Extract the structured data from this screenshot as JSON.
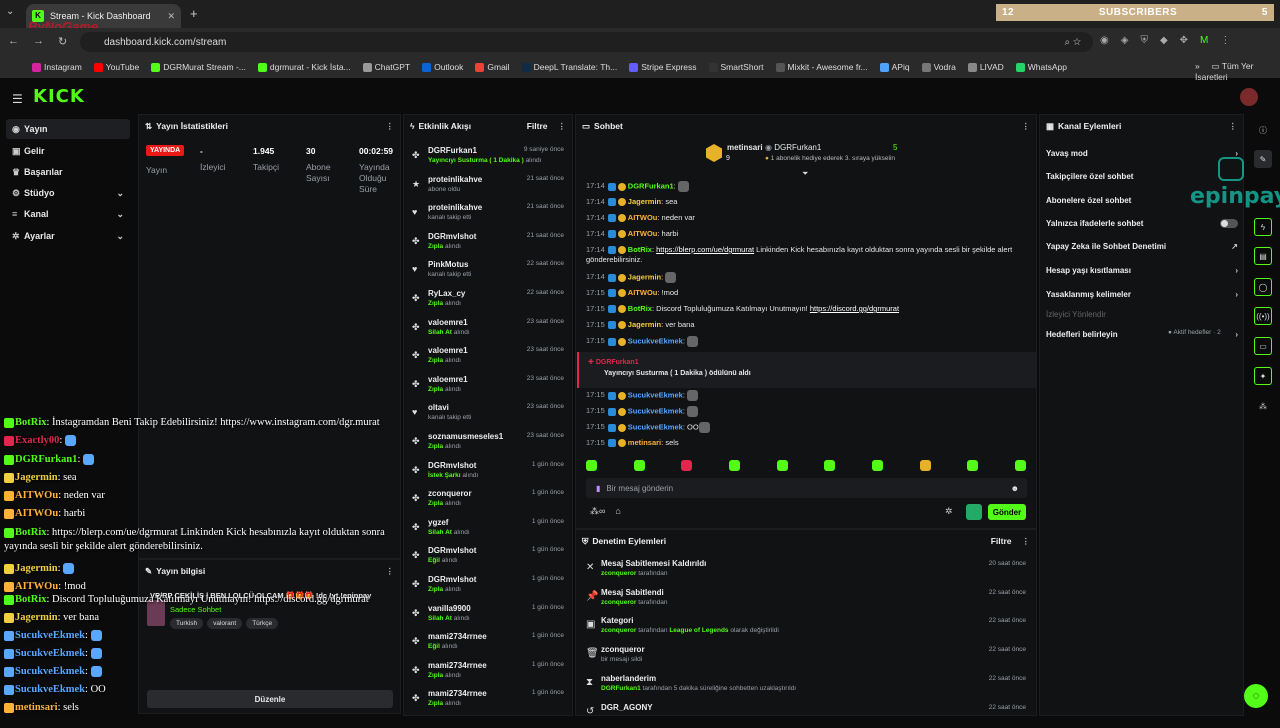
{
  "browser": {
    "tab_title": "Stream - Kick Dashboard",
    "url": "dashboard.kick.com/stream",
    "watermark": "ByNoGame",
    "subscribers": {
      "left": "12",
      "label": "SUBSCRIBERS",
      "right": "5"
    },
    "bookmarks": [
      "Instagram",
      "YouTube",
      "DGRMurat Stream -...",
      "dgrmurat - Kick İsta...",
      "ChatGPT",
      "Outlook",
      "Gmail",
      "DeepL Translate: Th...",
      "Stripe Express",
      "SmartShort",
      "Mixkit - Awesome fr...",
      "APiq",
      "Vodra",
      "LIVAD",
      "WhatsApp"
    ],
    "all_bookmarks": "Tüm Yer İşaretleri"
  },
  "app": {
    "logo": "KICK"
  },
  "sidebar": {
    "items": [
      {
        "label": "Yayın",
        "icon": "broadcast-icon"
      },
      {
        "label": "Gelir",
        "icon": "dollar-icon"
      },
      {
        "label": "Başarılar",
        "icon": "trophy-icon"
      },
      {
        "label": "Stüdyo",
        "icon": "studio-icon"
      },
      {
        "label": "Kanal",
        "icon": "channel-icon"
      },
      {
        "label": "Ayarlar",
        "icon": "gear-icon"
      }
    ]
  },
  "stats": {
    "title": "Yayın İstatistikleri",
    "live": "YAYINDA",
    "cells": [
      {
        "value": "",
        "label": "Yayın"
      },
      {
        "value": "-",
        "label": "İzleyici"
      },
      {
        "value": "1.945",
        "label": "Takipçi"
      },
      {
        "value": "30",
        "label": "Abone Sayısı"
      },
      {
        "value": "00:02:59",
        "label": "Yayında Olduğu Süre"
      }
    ]
  },
  "stream_info": {
    "title": "Yayın bilgisi",
    "stream_title": "VP/RP ÇEKİLİŞ | BEN LOLCÜ OLÇAM 🎁🎁🎁 !dc !yt !epinpay",
    "subtitle": "Sadece Sohbet",
    "tags": [
      "Turkish",
      "valorant",
      "Türkçe"
    ],
    "edit": "Düzenle"
  },
  "activity": {
    "title": "Etkinlik Akışı",
    "filter": "Filtre",
    "items": [
      {
        "name": "DGRFurkan1",
        "desc": "Yayıncıyı Susturma ( 1 Dakika )",
        "suffix": "alındı",
        "time": "9 saniye önce",
        "icon": "gift-icon"
      },
      {
        "name": "proteinlikahve",
        "desc": "",
        "suffix": "abone oldu",
        "time": "21 saat önce",
        "icon": "star-icon"
      },
      {
        "name": "proteinlikahve",
        "desc": "",
        "suffix": "kanalı takip etti",
        "time": "21 saat önce",
        "icon": "heart-icon"
      },
      {
        "name": "DGRmvlshot",
        "desc": "Zıpla",
        "suffix": "alındı",
        "time": "21 saat önce",
        "icon": "gift-icon"
      },
      {
        "name": "PinkMotus",
        "desc": "",
        "suffix": "kanalı takip etti",
        "time": "22 saat önce",
        "icon": "heart-icon"
      },
      {
        "name": "RyLax_cy",
        "desc": "Zıpla",
        "suffix": "alındı",
        "time": "22 saat önce",
        "icon": "gift-icon"
      },
      {
        "name": "valoemre1",
        "desc": "Silah At",
        "suffix": "alındı",
        "time": "23 saat önce",
        "icon": "gift-icon"
      },
      {
        "name": "valoemre1",
        "desc": "Zıpla",
        "suffix": "alındı",
        "time": "23 saat önce",
        "icon": "gift-icon"
      },
      {
        "name": "valoemre1",
        "desc": "Zıpla",
        "suffix": "alındı",
        "time": "23 saat önce",
        "icon": "gift-icon"
      },
      {
        "name": "oltavi",
        "desc": "",
        "suffix": "kanalı takip etti",
        "time": "23 saat önce",
        "icon": "heart-icon"
      },
      {
        "name": "soznamusmeseles1",
        "desc": "Zıpla",
        "suffix": "alındı",
        "time": "23 saat önce",
        "icon": "gift-icon"
      },
      {
        "name": "DGRmvlshot",
        "desc": "İstek Şarkı",
        "suffix": "alındı",
        "time": "1 gün önce",
        "icon": "gift-icon"
      },
      {
        "name": "zconqueror",
        "desc": "Zıpla",
        "suffix": "alındı",
        "time": "1 gün önce",
        "icon": "gift-icon"
      },
      {
        "name": "ygzef",
        "desc": "Silah At",
        "suffix": "alındı",
        "time": "1 gün önce",
        "icon": "gift-icon"
      },
      {
        "name": "DGRmvlshot",
        "desc": "Eğil",
        "suffix": "alındı",
        "time": "1 gün önce",
        "icon": "gift-icon"
      },
      {
        "name": "DGRmvlshot",
        "desc": "Zıpla",
        "suffix": "alındı",
        "time": "1 gün önce",
        "icon": "gift-icon"
      },
      {
        "name": "vanilla9900",
        "desc": "Silah At",
        "suffix": "alındı",
        "time": "1 gün önce",
        "icon": "gift-icon"
      },
      {
        "name": "mami2734rrnee",
        "desc": "Eğil",
        "suffix": "alındı",
        "time": "1 gün önce",
        "icon": "gift-icon"
      },
      {
        "name": "mami2734rrnee",
        "desc": "Zıpla",
        "suffix": "alındı",
        "time": "1 gün önce",
        "icon": "gift-icon"
      },
      {
        "name": "mami2734rrnee",
        "desc": "Zıpla",
        "suffix": "alındı",
        "time": "1 gün önce",
        "icon": "gift-icon"
      }
    ]
  },
  "chat": {
    "title": "Sohbet",
    "pinned": {
      "user": "metinsari",
      "gifter": "DGRFurkan1",
      "count_left": "9",
      "count_right": "5",
      "text": "1 abonelik hediye ederek 3. sıraya yükselin"
    },
    "messages": [
      {
        "time": "17:14",
        "user": "DGRFurkan1",
        "color": "u-g",
        "text": "",
        "emote": true
      },
      {
        "time": "17:14",
        "user": "Jagermin",
        "color": "u-y",
        "text": "sea"
      },
      {
        "time": "17:14",
        "user": "AITWOu",
        "color": "u-o",
        "text": "neden var"
      },
      {
        "time": "17:14",
        "user": "AITWOu",
        "color": "u-o",
        "text": "harbi"
      },
      {
        "time": "17:14",
        "user": "BotRix",
        "color": "u-g",
        "link": "https://blerp.com/ue/dgrmurat",
        "text": " Linkinden Kick hesabınızla kayıt olduktan sonra yayında sesli bir şekilde alert gönderebilirsiniz."
      },
      {
        "time": "17:14",
        "user": "Jagermin",
        "color": "u-y",
        "text": "",
        "emote": true
      },
      {
        "time": "17:15",
        "user": "AITWOu",
        "color": "u-o",
        "text": "!mod"
      },
      {
        "time": "17:15",
        "user": "BotRix",
        "color": "u-g",
        "text": "Discord Topluluğumuza Katılmayı Unutmayın! ",
        "link": "https://discord.gg/dgrmurat"
      },
      {
        "time": "17:15",
        "user": "Jagermin",
        "color": "u-y",
        "text": "ver bana"
      },
      {
        "time": "17:15",
        "user": "SucukveEkmek",
        "color": "u-b",
        "text": "",
        "emote": true
      }
    ],
    "redeem": {
      "user": "DGRFurkan1",
      "text": "Yayıncıyı Susturma ( 1 Dakika ) ödülünü aldı"
    },
    "messages2": [
      {
        "time": "17:15",
        "user": "SucukveEkmek",
        "color": "u-b",
        "text": "",
        "emote": true
      },
      {
        "time": "17:15",
        "user": "SucukveEkmek",
        "color": "u-b",
        "text": "",
        "emote": true
      },
      {
        "time": "17:15",
        "user": "SucukveEkmek",
        "color": "u-b",
        "text": "OO",
        "emote": true
      },
      {
        "time": "17:15",
        "user": "metinsari",
        "color": "u-o",
        "text": "sels"
      }
    ],
    "placeholder": "Bir mesaj gönderin",
    "send": "Gönder"
  },
  "moderation": {
    "title": "Denetim Eylemleri",
    "filter": "Filtre",
    "items": [
      {
        "title": "Mesaj Sabitlemesi Kaldırıldı",
        "user": "zconqueror",
        "desc": "tarafından",
        "extra": "",
        "tail": "",
        "time": "20 saat önce",
        "icon": "unpin-icon"
      },
      {
        "title": "Mesaj Sabitlendi",
        "user": "zconqueror",
        "desc": "tarafından",
        "extra": "",
        "tail": "",
        "time": "22 saat önce",
        "icon": "pin-icon"
      },
      {
        "title": "Kategori",
        "user": "zconqueror",
        "desc": "tarafından",
        "extra": "League of Legends",
        "tail": "olarak değiştirildi",
        "time": "22 saat önce",
        "icon": "category-icon"
      },
      {
        "title": "zconqueror",
        "user": "",
        "desc": "bir mesajı sildi",
        "extra": "",
        "tail": "",
        "time": "22 saat önce",
        "icon": "trash-icon"
      },
      {
        "title": "naberlanderim",
        "user": "DGRFurkan1",
        "desc": "tarafından 5 dakika süreliğine sohbetten uzaklaştırıldı",
        "extra": "",
        "tail": "",
        "time": "22 saat önce",
        "icon": "hourglass-icon"
      },
      {
        "title": "DGR_AGONY",
        "user": "",
        "desc": "",
        "extra": "",
        "tail": "",
        "time": "22 saat önce",
        "icon": "undo-icon"
      }
    ]
  },
  "channel_actions": {
    "title": "Kanal Eylemleri",
    "items": [
      {
        "label": "Yavaş mod",
        "right": "›"
      },
      {
        "label": "Takipçilere özel sohbet",
        "right": ""
      },
      {
        "label": "Abonelere özel sohbet",
        "right": ""
      },
      {
        "label": "Yalnızca ifadelerle sohbet",
        "right": "toggle"
      },
      {
        "label": "Yapay Zeka ile Sohbet Denetimi",
        "right": "↗"
      },
      {
        "label": "Hesap yaşı kısıtlaması",
        "right": "›"
      },
      {
        "label": "Yasaklanmış kelimeler",
        "right": "›"
      },
      {
        "label": "İzleyici Yönlendir",
        "right": ""
      },
      {
        "label": "Hedefleri belirleyin",
        "right": "›"
      }
    ],
    "goal_status": "● Aktif hedefler · 2",
    "epinpay": "epinpay"
  },
  "overlay": [
    {
      "user": "BotRix",
      "color": "#53fc18",
      "text": "İnstagramdan Beni Takip Edebilirsiniz! https://www.instagram.com/dgr.murat"
    },
    {
      "user": "Exactly00",
      "color": "#e2264d",
      "text": ""
    },
    {
      "user": "DGRFurkan1",
      "color": "#53fc18",
      "text": ""
    },
    {
      "user": "Jagermin",
      "color": "#f0d040",
      "text": "sea"
    },
    {
      "user": "AITWOu",
      "color": "#ffb13a",
      "text": "neden var"
    },
    {
      "user": "AITWOu",
      "color": "#ffb13a",
      "text": "harbi"
    },
    {
      "user": "BotRix",
      "color": "#53fc18",
      "text": "https://blerp.com/ue/dgrmurat Linkinden Kick hesabınızla kayıt olduktan sonra"
    },
    {
      "user": "",
      "color": "#fff",
      "text": "yayında sesli bir şekilde alert gönderebilirsiniz."
    },
    {
      "user": "Jagermin",
      "color": "#f0d040",
      "text": ""
    },
    {
      "user": "AITWOu",
      "color": "#ffb13a",
      "text": "!mod"
    },
    {
      "user": "BotRix",
      "color": "#53fc18",
      "text": "Discord Topluluğumuza Katılmayı Unutmayın! https://discord.gg/dgrmurat"
    },
    {
      "user": "Jagermin",
      "color": "#f0d040",
      "text": "ver bana"
    },
    {
      "user": "SucukveEkmek",
      "color": "#5aa7ff",
      "text": ""
    },
    {
      "user": "SucukveEkmek",
      "color": "#5aa7ff",
      "text": ""
    },
    {
      "user": "SucukveEkmek",
      "color": "#5aa7ff",
      "text": ""
    },
    {
      "user": "SucukveEkmek",
      "color": "#5aa7ff",
      "text": "OO"
    },
    {
      "user": "metinsari",
      "color": "#ffb13a",
      "text": "sels"
    }
  ]
}
